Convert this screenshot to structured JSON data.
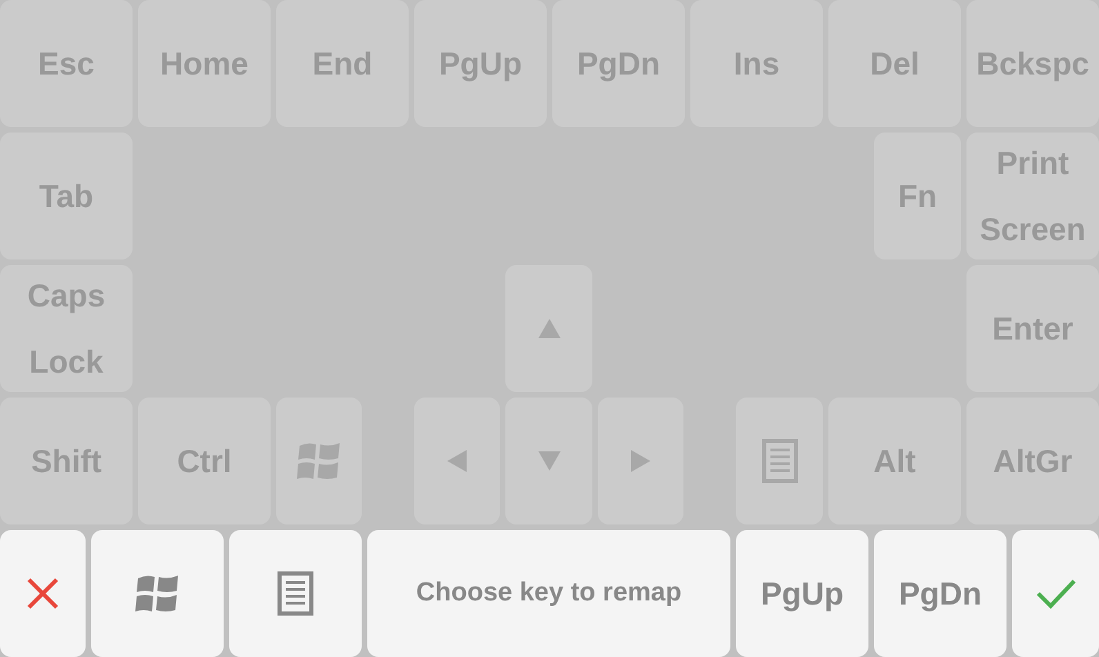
{
  "keyboard": {
    "disabled": true,
    "keys": [
      {
        "kind": "label",
        "label": "Esc"
      },
      {
        "kind": "label",
        "label": "Home"
      },
      {
        "kind": "label",
        "label": "End"
      },
      {
        "kind": "label",
        "label": "PgUp"
      },
      {
        "kind": "label",
        "label": "PgDn"
      },
      {
        "kind": "label",
        "label": "Ins"
      },
      {
        "kind": "label",
        "label": "Del"
      },
      {
        "kind": "label",
        "label": "Bckspc"
      },
      {
        "kind": "label",
        "label": "Tab"
      },
      {
        "kind": "label",
        "label": "Fn"
      },
      {
        "kind": "label",
        "label": "Print Screen"
      },
      {
        "kind": "label",
        "label": "Caps Lock"
      },
      {
        "kind": "up"
      },
      {
        "kind": "label",
        "label": "Enter"
      },
      {
        "kind": "label",
        "label": "Shift"
      },
      {
        "kind": "label",
        "label": "Ctrl"
      },
      {
        "kind": "logo"
      },
      {
        "kind": "left"
      },
      {
        "kind": "down"
      },
      {
        "kind": "right"
      },
      {
        "kind": "menu"
      },
      {
        "kind": "label",
        "label": "Alt"
      },
      {
        "kind": "label",
        "label": "AltGr"
      }
    ]
  },
  "toolbar": [
    {
      "kind": "cancel"
    },
    {
      "kind": "logo"
    },
    {
      "kind": "menu"
    },
    {
      "kind": "prompt",
      "label": "Choose key to remap"
    },
    {
      "kind": "label",
      "label": "PgUp"
    },
    {
      "kind": "label",
      "label": "PgDn"
    },
    {
      "kind": "confirm"
    }
  ]
}
